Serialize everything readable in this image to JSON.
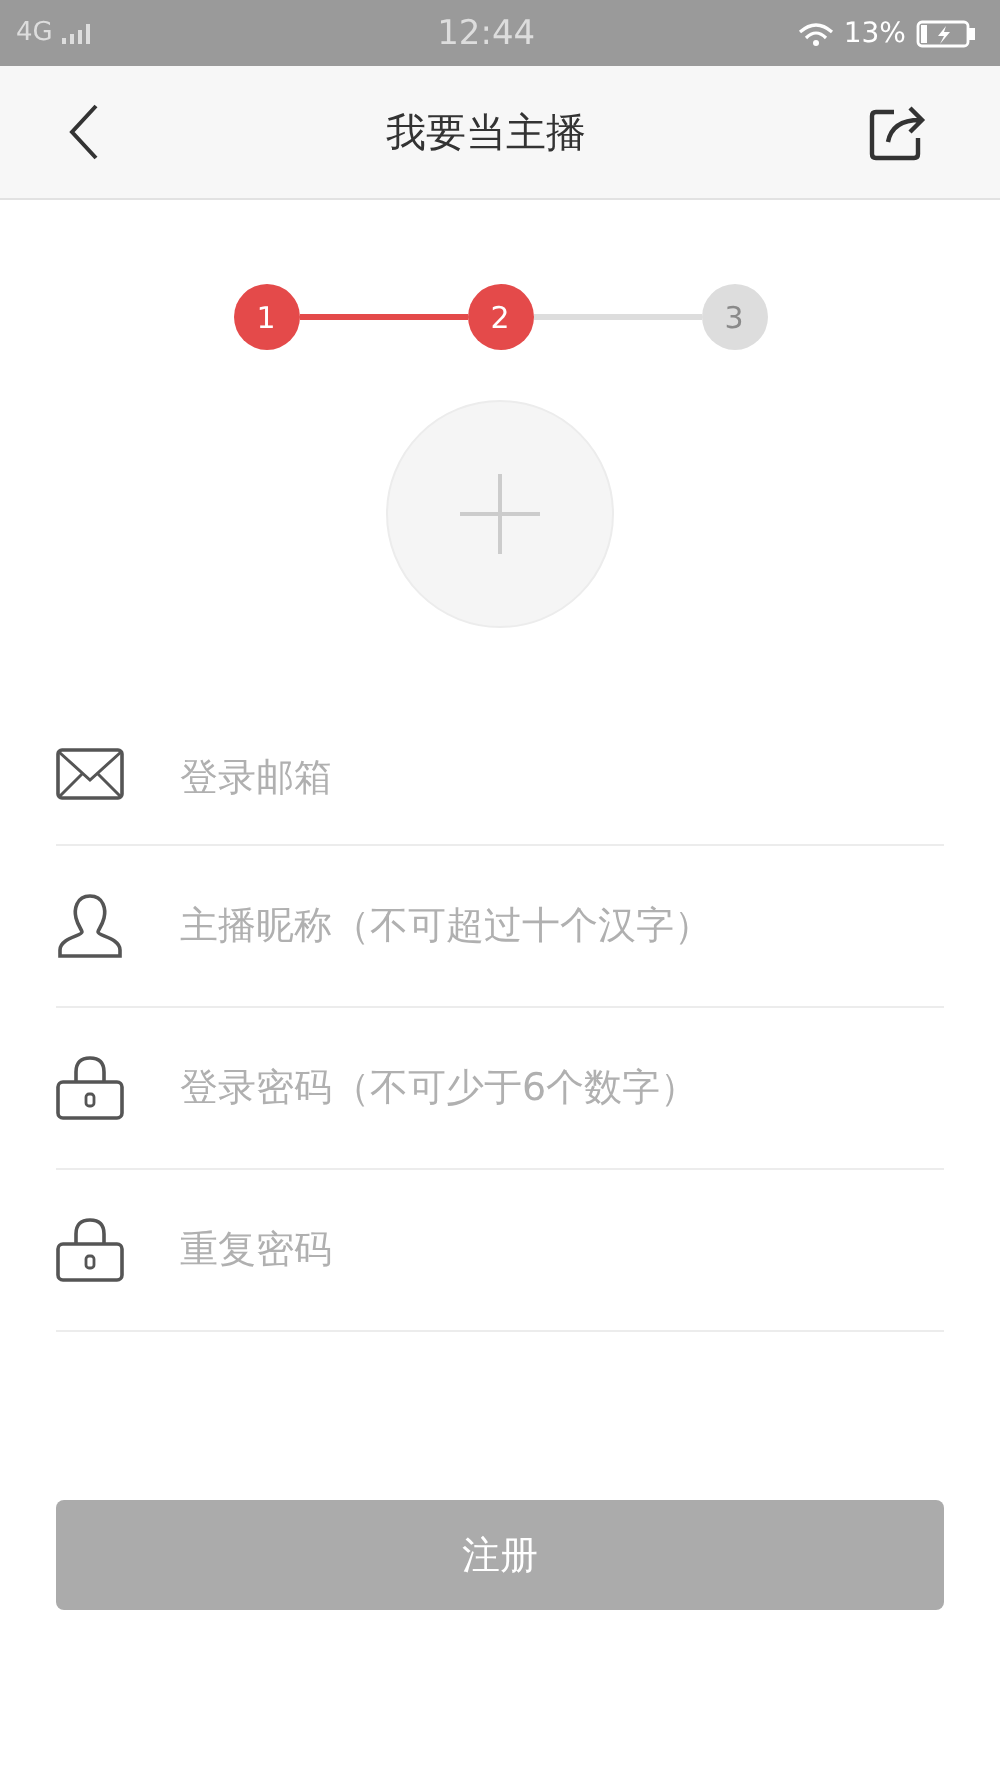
{
  "status_bar": {
    "network": "4G",
    "time": "12:44",
    "battery": "13%"
  },
  "header": {
    "title": "我要当主播"
  },
  "steps": [
    {
      "label": "1",
      "active": true
    },
    {
      "label": "2",
      "active": true
    },
    {
      "label": "3",
      "active": false
    }
  ],
  "fields": [
    {
      "kind": "mail",
      "placeholder": "登录邮箱"
    },
    {
      "kind": "person",
      "placeholder": "主播昵称（不可超过十个汉字）"
    },
    {
      "kind": "lock",
      "placeholder": "登录密码（不可少于6个数字）"
    },
    {
      "kind": "lock",
      "placeholder": "重复密码"
    }
  ],
  "submit": {
    "label": "注册",
    "disabled": true
  }
}
